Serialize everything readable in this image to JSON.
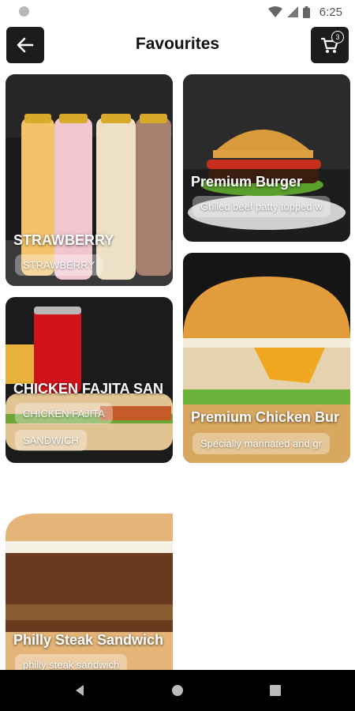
{
  "status_bar": {
    "time": "6:25"
  },
  "header": {
    "title": "Favourites",
    "cart_count": "3"
  },
  "colors": {
    "header_button_bg": "#1c1c1c",
    "page_bg": "#ffffff"
  },
  "cards": [
    {
      "title": "STRAWBERRY",
      "tags": [
        "STRAWBERRY"
      ],
      "image": "milkshake-bottles"
    },
    {
      "title": "Premium Burger",
      "tags": [
        "Grilled beef patty topped w"
      ],
      "image": "beef-burger"
    },
    {
      "title": "CHICKEN FAJITA  SAN",
      "tags": [
        "CHICKEN FAJITA",
        "SANDWICH"
      ],
      "image": "fajita-sandwich-with-cola"
    },
    {
      "title": "Premium Chicken Bur",
      "tags": [
        "Specially marinated and gr"
      ],
      "image": "chicken-burger"
    },
    {
      "title": "Philly Steak Sandwich",
      "tags": [
        "philly steak sandwich"
      ],
      "image": "philly-steak-sandwich"
    }
  ]
}
